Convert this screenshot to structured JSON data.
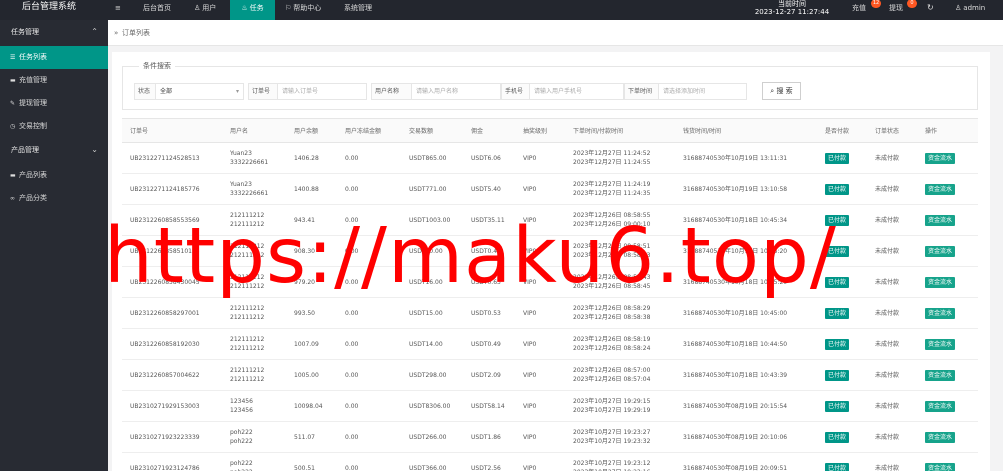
{
  "app": {
    "title": "后台管理系统"
  },
  "topnav": {
    "menu_toggle": "≡",
    "items": [
      {
        "label": "后台首页"
      },
      {
        "label": "用户"
      },
      {
        "label": "任务"
      },
      {
        "label": "帮助中心"
      },
      {
        "label": "系统管理"
      }
    ],
    "clock_label": "当前时间",
    "clock_value": "2023-12-27 11:27:44",
    "recharge_label": "充值",
    "recharge_badge": "12",
    "withdraw_label": "提现",
    "withdraw_badge": "0",
    "user_label": "admin"
  },
  "sidebar": {
    "group1": "任务管理",
    "group1_items": [
      {
        "label": "任务列表"
      },
      {
        "label": "充值管理"
      },
      {
        "label": "提现管理"
      },
      {
        "label": "交易控制"
      }
    ],
    "group2": "产品管理",
    "group2_items": [
      {
        "label": "产品列表"
      },
      {
        "label": "产品分类"
      }
    ]
  },
  "breadcrumb": {
    "arrows": "»",
    "current": "订单列表"
  },
  "filters": {
    "legend": "条件搜索",
    "status_label": "状态",
    "status_value": "全部",
    "order_no_label": "订单号",
    "order_no_placeholder": "请输入订单号",
    "user_name_label": "用户名称",
    "user_name_placeholder": "请输入用户名称",
    "phone_label": "手机号",
    "phone_placeholder": "请输入用户手机号",
    "order_time_label": "下单时间",
    "order_time_placeholder": "请选择添加时间",
    "search_button": "搜 索"
  },
  "table": {
    "headers": [
      "订单号",
      "用户名",
      "用户余额",
      "用户冻结金额",
      "交易数额",
      "佣金",
      "抽奖级别",
      "下单时间/付款时间",
      "钱货时间/时间",
      "是否付款",
      "订单状态",
      "操作"
    ],
    "rows": [
      {
        "order": "UB2312271124528513",
        "user1": "Yuan23",
        "user2": "3332226661",
        "balance": "1406.28",
        "frozen": "0.00",
        "amount": "USDT865.00",
        "commission": "USDT6.06",
        "level": "VIP0",
        "t1": "2023年12月27日 11:24:52",
        "t2": "2023年12月27日 11:24:55",
        "t3": "31688740530年10月19日 13:11:31",
        "paid": "已付款",
        "status": "未成付款",
        "op": "资金流水"
      },
      {
        "order": "UB2312271124185776",
        "user1": "Yuan23",
        "user2": "3332226661",
        "balance": "1400.88",
        "frozen": "0.00",
        "amount": "USDT771.00",
        "commission": "USDT5.40",
        "level": "VIP0",
        "t1": "2023年12月27日 11:24:19",
        "t2": "2023年12月27日 11:24:35",
        "t3": "31688740530年10月19日 13:10:58",
        "paid": "已付款",
        "status": "未成付款",
        "op": "资金流水"
      },
      {
        "order": "UB2312260858553569",
        "user1": "212111212",
        "user2": "212111212",
        "balance": "943.41",
        "frozen": "0.00",
        "amount": "USDT1003.00",
        "commission": "USDT35.11",
        "level": "VIP0",
        "t1": "2023年12月26日 08:58:55",
        "t2": "2023年12月26日 09:00:10",
        "t3": "31688740530年10月18日 10:45:34",
        "paid": "已付款",
        "status": "未成付款",
        "op": "资金流水"
      },
      {
        "order": "UB2312260858510123",
        "user1": "212111212",
        "user2": "212111212",
        "balance": "908.30",
        "frozen": "0.00",
        "amount": "USDT10.00",
        "commission": "USDT0.40",
        "level": "VIP0",
        "t1": "2023年12月26日 08:58:51",
        "t2": "2023年12月26日 08:58:53",
        "t3": "31688740530年10月18日 10:45:20",
        "paid": "已付款",
        "status": "未成付款",
        "op": "资金流水"
      },
      {
        "order": "UB2312260858430045",
        "user1": "212111212",
        "user2": "212111212",
        "balance": "979.20",
        "frozen": "0.00",
        "amount": "USDT16.00",
        "commission": "USDT0.63",
        "level": "VIP0",
        "t1": "2023年12月26日 08:58:43",
        "t2": "2023年12月26日 08:58:45",
        "t3": "31688740530年10月18日 10:45:20",
        "paid": "已付款",
        "status": "未成付款",
        "op": "资金流水"
      },
      {
        "order": "UB2312260858297001",
        "user1": "212111212",
        "user2": "212111212",
        "balance": "993.50",
        "frozen": "0.00",
        "amount": "USDT15.00",
        "commission": "USDT0.53",
        "level": "VIP0",
        "t1": "2023年12月26日 08:58:29",
        "t2": "2023年12月26日 08:58:38",
        "t3": "31688740530年10月18日 10:45:00",
        "paid": "已付款",
        "status": "未成付款",
        "op": "资金流水"
      },
      {
        "order": "UB2312260858192030",
        "user1": "212111212",
        "user2": "212111212",
        "balance": "1007.09",
        "frozen": "0.00",
        "amount": "USDT14.00",
        "commission": "USDT0.49",
        "level": "VIP0",
        "t1": "2023年12月26日 08:58:19",
        "t2": "2023年12月26日 08:58:24",
        "t3": "31688740530年10月18日 10:44:50",
        "paid": "已付款",
        "status": "未成付款",
        "op": "资金流水"
      },
      {
        "order": "UB2312260857004622",
        "user1": "212111212",
        "user2": "212111212",
        "balance": "1005.00",
        "frozen": "0.00",
        "amount": "USDT298.00",
        "commission": "USDT2.09",
        "level": "VIP0",
        "t1": "2023年12月26日 08:57:00",
        "t2": "2023年12月26日 08:57:04",
        "t3": "31688740530年10月18日 10:43:39",
        "paid": "已付款",
        "status": "未成付款",
        "op": "资金流水"
      },
      {
        "order": "UB2310271929153003",
        "user1": "123456",
        "user2": "123456",
        "balance": "10098.04",
        "frozen": "0.00",
        "amount": "USDT8306.00",
        "commission": "USDT58.14",
        "level": "VIP0",
        "t1": "2023年10月27日 19:29:15",
        "t2": "2023年10月27日 19:29:19",
        "t3": "31688740530年08月19日 20:15:54",
        "paid": "已付款",
        "status": "未成付款",
        "op": "资金流水"
      },
      {
        "order": "UB2310271923223339",
        "user1": "poh222",
        "user2": "poh222",
        "balance": "511.07",
        "frozen": "0.00",
        "amount": "USDT266.00",
        "commission": "USDT1.86",
        "level": "VIP0",
        "t1": "2023年10月27日 19:23:27",
        "t2": "2023年10月27日 19:23:32",
        "t3": "31688740530年08月19日 20:10:06",
        "paid": "已付款",
        "status": "未成付款",
        "op": "资金流水"
      },
      {
        "order": "UB2310271923124786",
        "user1": "poh222",
        "user2": "poh222",
        "balance": "500.51",
        "frozen": "0.00",
        "amount": "USDT366.00",
        "commission": "USDT2.56",
        "level": "VIP0",
        "t1": "2023年10月27日 19:23:12",
        "t2": "2023年10月27日 19:23:16",
        "t3": "31688740530年08月19日 20:09:51",
        "paid": "已付款",
        "status": "未成付款",
        "op": "资金流水"
      }
    ]
  },
  "watermark": "https://maku6.top/",
  "colors": {
    "accent": "#009688",
    "topbar": "#23262e",
    "sidebar": "#282b33",
    "badge": "#ff5722",
    "watermark": "#ff0000"
  }
}
